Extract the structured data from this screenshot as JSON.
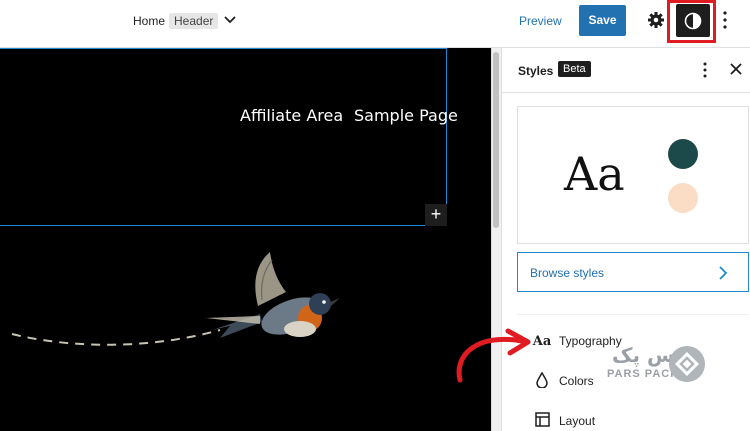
{
  "topbar": {
    "breadcrumb_home": "Home",
    "breadcrumb_template_part": "Header",
    "preview_label": "Preview",
    "save_label": "Save"
  },
  "canvas": {
    "nav_items": [
      "Affiliate Area",
      "Sample Page"
    ],
    "add_block_label": "+"
  },
  "sidebar": {
    "title": "Styles",
    "badge": "Beta",
    "preview_text": "Aa",
    "swatch_colors": [
      "#1c4a4a",
      "#fbdcc4"
    ],
    "browse_label": "Browse styles",
    "menu": [
      {
        "label": "Typography",
        "icon": "Aa"
      },
      {
        "label": "Colors",
        "icon": "droplet-icon"
      },
      {
        "label": "Layout",
        "icon": "layout-icon"
      }
    ]
  },
  "watermark": {
    "text_fa": "پارس پک",
    "text_en": "PARS PACK"
  },
  "colors": {
    "accent": "#2271b1",
    "highlight_outline": "#e01b22",
    "canvas_bg": "#000000"
  }
}
